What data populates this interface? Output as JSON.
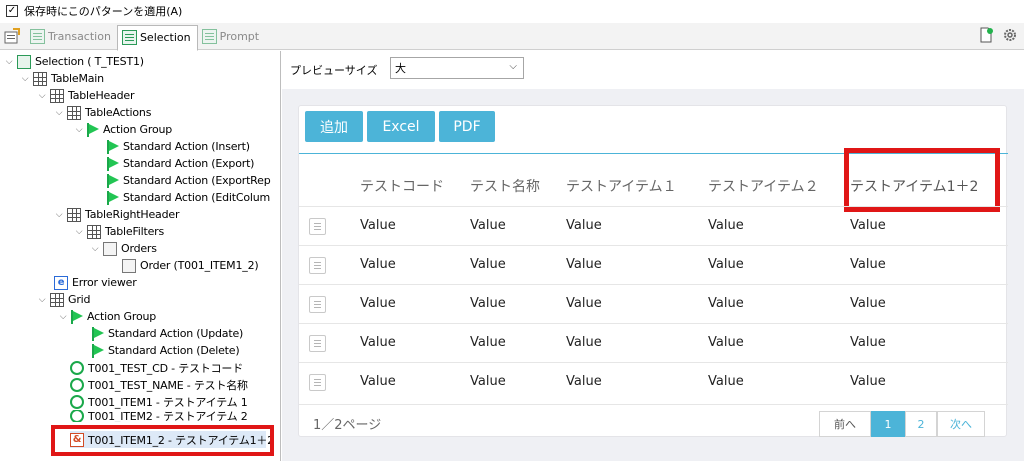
{
  "top": {
    "checkbox_label": "保存時にこのパターンを適用(A)",
    "checked": true,
    "check_mark": "✓"
  },
  "tabs": [
    {
      "label": "Transaction",
      "active": false
    },
    {
      "label": "Selection",
      "active": true
    },
    {
      "label": "Prompt",
      "active": false
    }
  ],
  "tree": {
    "root": "Selection ( T_TEST1)",
    "table_main": "TableMain",
    "table_header": "TableHeader",
    "table_actions": "TableActions",
    "action_group_1": "Action Group",
    "actions_1": [
      "Standard Action (Insert)",
      "Standard Action (Export)",
      "Standard Action (ExportRep",
      "Standard Action (EditColum"
    ],
    "table_right_header": "TableRightHeader",
    "table_filters": "TableFilters",
    "orders": "Orders",
    "order_item": "Order (T001_ITEM1_2)",
    "error_viewer": "Error viewer",
    "grid": "Grid",
    "action_group_2": "Action Group",
    "actions_2": [
      "Standard Action (Update)",
      "Standard Action (Delete)"
    ],
    "fields": [
      "T001_TEST_CD - テストコード",
      "T001_TEST_NAME - テスト名称",
      "T001_ITEM1 - テストアイテム 1",
      "T001_ITEM2 - テストアイテム 2"
    ],
    "selected_field": "T001_ITEM1_2 - テストアイテム1＋2"
  },
  "preview": {
    "label": "プレビューサイズ",
    "value": "大"
  },
  "toolbar": {
    "add": "追加",
    "excel": "Excel",
    "pdf": "PDF"
  },
  "table": {
    "headers": [
      "テストコード",
      "テスト名称",
      "テストアイテム１",
      "テストアイテム２",
      "テストアイテム1＋2"
    ],
    "rows": [
      [
        "Value",
        "Value",
        "Value",
        "Value",
        "Value"
      ],
      [
        "Value",
        "Value",
        "Value",
        "Value",
        "Value"
      ],
      [
        "Value",
        "Value",
        "Value",
        "Value",
        "Value"
      ],
      [
        "Value",
        "Value",
        "Value",
        "Value",
        "Value"
      ],
      [
        "Value",
        "Value",
        "Value",
        "Value",
        "Value"
      ]
    ]
  },
  "pager": {
    "label": "1／2ページ",
    "prev": "前へ",
    "page1": "1",
    "page2": "2",
    "next": "次へ"
  },
  "colors": {
    "accent": "#4cb4d8",
    "highlight": "#e01616",
    "flag": "#22c553"
  }
}
